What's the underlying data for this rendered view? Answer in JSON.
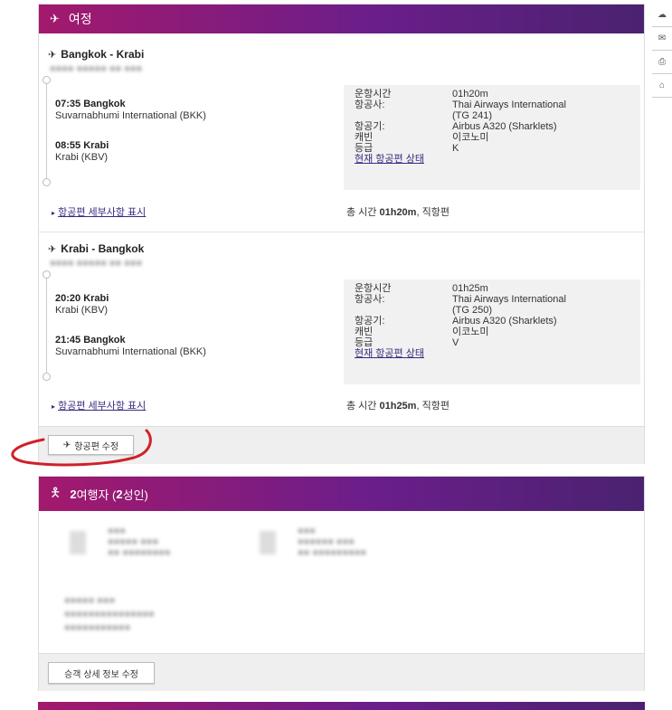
{
  "itinerary": {
    "header": "여정",
    "legs": [
      {
        "title": "Bangkok - Krabi",
        "dep_time": "07:35 Bangkok",
        "dep_airport": "Suvarnabhumi International (BKK)",
        "arr_time": "08:55 Krabi",
        "arr_airport": "Krabi (KBV)",
        "rows": [
          {
            "k": "운항시간",
            "v": "01h20m"
          },
          {
            "k": "항공사:",
            "v": "Thai Airways International"
          },
          {
            "k": "",
            "v": "(TG 241)"
          },
          {
            "k": "항공기:",
            "v": "Airbus A320 (Sharklets)"
          },
          {
            "k": "캐빈",
            "v": "이코노미"
          },
          {
            "k": "등급",
            "v": "K"
          }
        ],
        "status_link": "현재 항공편 상태",
        "details_link": "항공편 세부사항 표시",
        "total_prefix": "총 시간 ",
        "total_bold": "01h20m",
        "total_suffix": ", 직항편"
      },
      {
        "title": "Krabi - Bangkok",
        "dep_time": "20:20 Krabi",
        "dep_airport": "Krabi (KBV)",
        "arr_time": "21:45 Bangkok",
        "arr_airport": "Suvarnabhumi International (BKK)",
        "rows": [
          {
            "k": "운항시간",
            "v": "01h25m"
          },
          {
            "k": "항공사:",
            "v": "Thai Airways International"
          },
          {
            "k": "",
            "v": "(TG 250)"
          },
          {
            "k": "항공기:",
            "v": "Airbus A320 (Sharklets)"
          },
          {
            "k": "캐빈",
            "v": "이코노미"
          },
          {
            "k": "등급",
            "v": "V"
          }
        ],
        "status_link": "현재 항공편 상태",
        "details_link": "항공편 세부사항 표시",
        "total_prefix": "총 시간 ",
        "total_bold": "01h25m",
        "total_suffix": ", 직항편"
      }
    ],
    "edit_flight_button": "항공편 수정"
  },
  "travelers": {
    "header_count": "2",
    "header_text": " 여행자 (",
    "header_count2": "2",
    "header_text2": " 성인)",
    "edit_button": "승객 상세 정보 수정"
  },
  "colors": {
    "annotation": "#d0202a",
    "accent": "#8b1a7a"
  }
}
